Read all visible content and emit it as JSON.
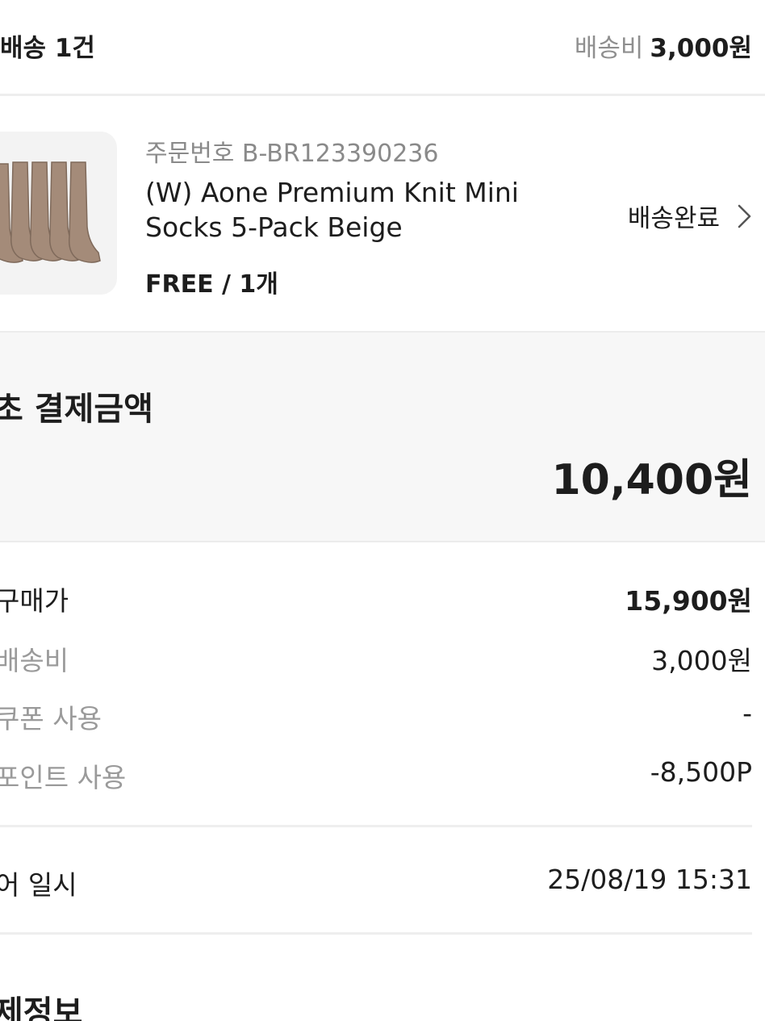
{
  "shipping": {
    "count_label": "배송 1건",
    "fee_label": "배송비",
    "fee_value": "3,000원"
  },
  "product": {
    "order_number": "주문번호 B-BR123390236",
    "name": "(W) Aone Premium Knit Mini Socks 5-Pack Beige",
    "option": "FREE / 1개",
    "status": "배송완료",
    "image_icon": "beige-socks-image"
  },
  "total": {
    "title": "초 결제금액",
    "amount": "10,400원"
  },
  "breakdown": [
    {
      "label": "구매가",
      "value": "15,900원"
    },
    {
      "label": "배송비",
      "value": "3,000원"
    },
    {
      "label": "쿠폰 사용",
      "value": "-"
    },
    {
      "label": "포인트 사용",
      "value": "-8,500P"
    }
  ],
  "datetime": {
    "label": "어 일시",
    "value": "25/08/19 15:31"
  },
  "next_section": {
    "title": "제정보"
  },
  "colors": {
    "text": "#1d1d1d",
    "muted": "#8f8f8f",
    "panel": "#f7f7f7",
    "divider": "#eeeeee"
  }
}
